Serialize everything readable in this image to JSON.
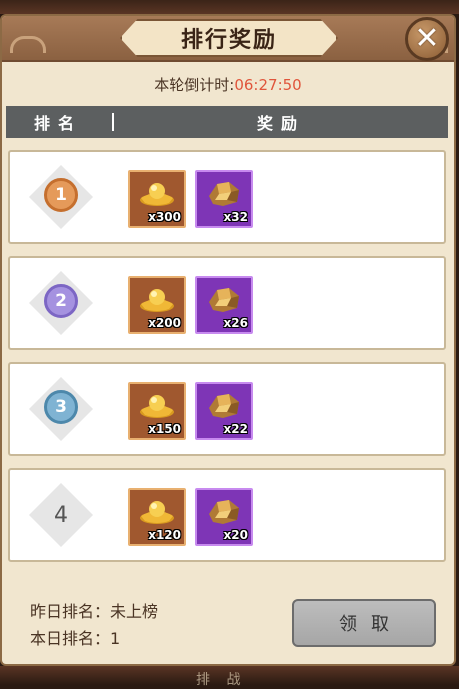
{
  "dialog": {
    "title": "排行奖励",
    "countdown_label": "本轮倒计时:",
    "countdown_time": "06:27:50"
  },
  "table": {
    "col_rank": "排名",
    "col_reward": "奖励"
  },
  "rows": [
    {
      "rank": "1",
      "medal": "gold",
      "gold_qty": "x300",
      "ore_qty": "x32"
    },
    {
      "rank": "2",
      "medal": "purple",
      "gold_qty": "x200",
      "ore_qty": "x26"
    },
    {
      "rank": "3",
      "medal": "blue",
      "gold_qty": "x150",
      "ore_qty": "x22"
    },
    {
      "rank": "4",
      "medal": "plain",
      "gold_qty": "x120",
      "ore_qty": "x20"
    }
  ],
  "footer": {
    "yesterday": "昨日排名：未上榜",
    "today": "本日排名：1",
    "claim_label": "领取"
  },
  "background": {
    "bottom_text": "排 战"
  },
  "icons": {
    "close": "close-icon",
    "gold_ingot": "gold-ingot-icon",
    "ore": "ore-icon"
  },
  "colors": {
    "countdown_time": "#e0553b",
    "header_bar": "#5c5f60",
    "panel_bg": "#f1e6cf"
  }
}
